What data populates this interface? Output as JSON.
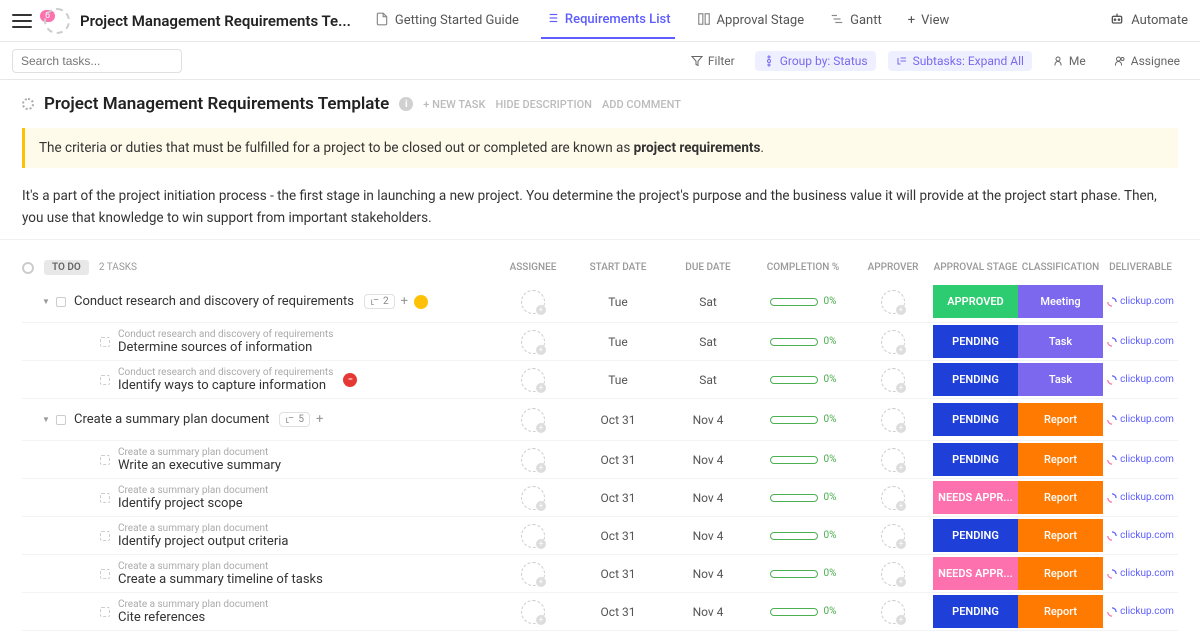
{
  "nav": {
    "badge": "6",
    "title": "Project Management Requirements Te...",
    "tabs": [
      {
        "label": "Getting Started Guide"
      },
      {
        "label": "Requirements List"
      },
      {
        "label": "Approval Stage"
      },
      {
        "label": "Gantt"
      },
      {
        "label": "View"
      }
    ],
    "automate": "Automate"
  },
  "filter": {
    "search_placeholder": "Search tasks...",
    "filter": "Filter",
    "groupby": "Group by: Status",
    "subtasks": "Subtasks: Expand All",
    "me": "Me",
    "assignee": "Assignee"
  },
  "header": {
    "title": "Project Management Requirements Template",
    "new_task": "+ NEW TASK",
    "hide_desc": "HIDE DESCRIPTION",
    "add_comment": "ADD COMMENT",
    "callout_prefix": "The criteria or duties that must be fulfilled for a project to be closed out or completed are known as ",
    "callout_bold": "project requirements",
    "desc": "It's a part of the project initiation process - the first stage in launching a new project. You determine the project's purpose and the business value it will provide at the project start phase. Then, you use that knowledge to win support from important stakeholders."
  },
  "group": {
    "status": "TO DO",
    "count": "2 TASKS"
  },
  "columns": {
    "assignee": "ASSIGNEE",
    "start": "START DATE",
    "due": "DUE DATE",
    "completion": "COMPLETION %",
    "approver": "APPROVER",
    "stage": "APPROVAL STAGE",
    "classification": "CLASSIFICATION",
    "deliverable": "DELIVERABLE"
  },
  "tasks": [
    {
      "name": "Conduct research and discovery of requirements",
      "sub_count": "2",
      "dot": "yellow",
      "start": "Tue",
      "due": "Sat",
      "pct": "0%",
      "stage": "APPROVED",
      "stage_class": "stage-approved",
      "classification": "Meeting",
      "class_class": "class-meeting",
      "deliv": "clickup.com",
      "subtasks": [
        {
          "parent": "Conduct research and discovery of requirements",
          "name": "Determine sources of information",
          "start": "Tue",
          "due": "Sat",
          "pct": "0%",
          "stage": "PENDING",
          "stage_class": "stage-pending",
          "classification": "Task",
          "class_class": "class-task",
          "deliv": "clickup.com"
        },
        {
          "parent": "Conduct research and discovery of requirements",
          "name": "Identify ways to capture information",
          "stop": true,
          "start": "Tue",
          "due": "Sat",
          "pct": "0%",
          "stage": "PENDING",
          "stage_class": "stage-pending",
          "classification": "Task",
          "class_class": "class-task",
          "deliv": "clickup.com"
        }
      ]
    },
    {
      "name": "Create a summary plan document",
      "sub_count": "5",
      "start": "Oct 31",
      "due": "Nov 4",
      "pct": "0%",
      "stage": "PENDING",
      "stage_class": "stage-pending",
      "classification": "Report",
      "class_class": "class-report",
      "deliv": "clickup.com",
      "subtasks": [
        {
          "parent": "Create a summary plan document",
          "name": "Write an executive summary",
          "start": "Oct 31",
          "due": "Nov 4",
          "pct": "0%",
          "stage": "PENDING",
          "stage_class": "stage-pending",
          "classification": "Report",
          "class_class": "class-report",
          "deliv": "clickup.com"
        },
        {
          "parent": "Create a summary plan document",
          "name": "Identify project scope",
          "start": "Oct 31",
          "due": "Nov 4",
          "pct": "0%",
          "stage": "NEEDS APPR...",
          "stage_class": "stage-needs",
          "classification": "Report",
          "class_class": "class-report",
          "deliv": "clickup.com"
        },
        {
          "parent": "Create a summary plan document",
          "name": "Identify project output criteria",
          "start": "Oct 31",
          "due": "Nov 4",
          "pct": "0%",
          "stage": "PENDING",
          "stage_class": "stage-pending",
          "classification": "Report",
          "class_class": "class-report",
          "deliv": "clickup.com"
        },
        {
          "parent": "Create a summary plan document",
          "name": "Create a summary timeline of tasks",
          "start": "Oct 31",
          "due": "Nov 4",
          "pct": "0%",
          "stage": "NEEDS APPR...",
          "stage_class": "stage-needs",
          "classification": "Report",
          "class_class": "class-report",
          "deliv": "clickup.com"
        },
        {
          "parent": "Create a summary plan document",
          "name": "Cite references",
          "start": "Oct 31",
          "due": "Nov 4",
          "pct": "0%",
          "stage": "PENDING",
          "stage_class": "stage-pending",
          "classification": "Report",
          "class_class": "class-report",
          "deliv": "clickup.com"
        }
      ]
    }
  ]
}
